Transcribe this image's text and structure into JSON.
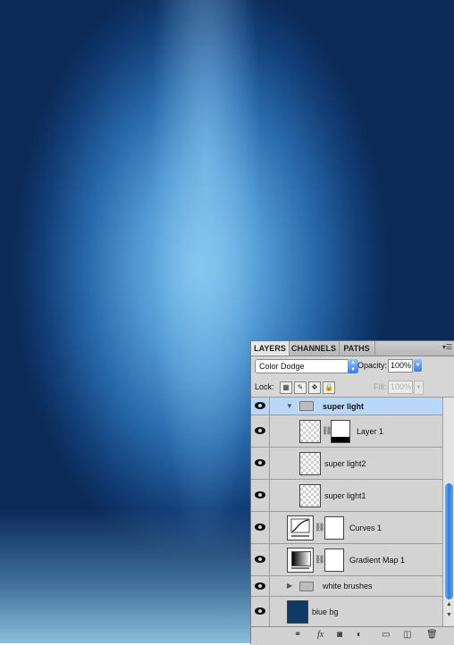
{
  "panel": {
    "tabs": [
      "LAYERS",
      "CHANNELS",
      "PATHS"
    ],
    "menu_icon": "panel-menu-icon",
    "blend_mode": "Color Dodge",
    "opacity_label": "Opacity:",
    "opacity_value": "100%",
    "lock_label": "Lock:",
    "fill_label": "Fill:",
    "fill_value": "100%"
  },
  "layers": [
    {
      "name": "super light",
      "type": "group-open",
      "selected": true
    },
    {
      "name": "Layer 1",
      "type": "pixel-with-mask"
    },
    {
      "name": "super light2",
      "type": "pixel"
    },
    {
      "name": "super light1",
      "type": "pixel"
    },
    {
      "name": "Curves 1",
      "type": "adjustment-curves"
    },
    {
      "name": "Gradient Map 1",
      "type": "adjustment-gradient-map"
    },
    {
      "name": "white brushes",
      "type": "group-closed"
    },
    {
      "name": "blue bg",
      "type": "fill",
      "color": "#0f3a63"
    }
  ],
  "colors": {
    "selected_row": "#b9d8f7",
    "canvas_dark": "#0b2a58",
    "canvas_light": "#7cc4ee"
  }
}
